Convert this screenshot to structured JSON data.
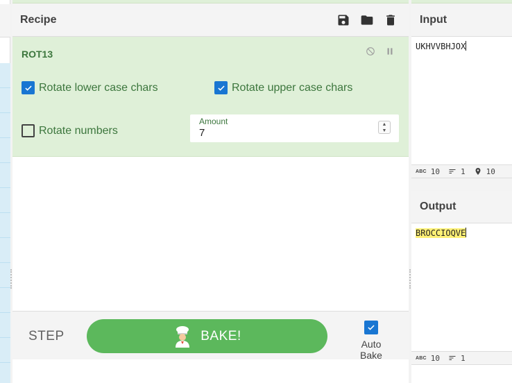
{
  "recipe": {
    "title": "Recipe",
    "icons": [
      "save-icon",
      "folder-icon",
      "trash-icon"
    ],
    "operation": {
      "name": "ROT13",
      "rotate_lower_label": "Rotate lower case chars",
      "rotate_lower_checked": true,
      "rotate_upper_label": "Rotate upper case chars",
      "rotate_upper_checked": true,
      "rotate_numbers_label": "Rotate numbers",
      "rotate_numbers_checked": false,
      "amount_label": "Amount",
      "amount_value": "7"
    },
    "step_label": "STEP",
    "bake_label": "BAKE!",
    "auto_bake_label": "Auto Bake",
    "auto_bake_checked": true
  },
  "input": {
    "title": "Input",
    "value": "UKHVVBHJOX",
    "status": {
      "length": "10",
      "lines": "1",
      "position": "10"
    }
  },
  "output": {
    "title": "Output",
    "value": "BROCCIOQVE",
    "status": {
      "length": "10",
      "lines": "1"
    }
  },
  "colors": {
    "operation_bg": "#dff0d8",
    "operation_text": "#3c763d",
    "bake_button": "#5cb85c",
    "checkbox_on": "#1976d2",
    "output_highlight": "#fff176"
  }
}
